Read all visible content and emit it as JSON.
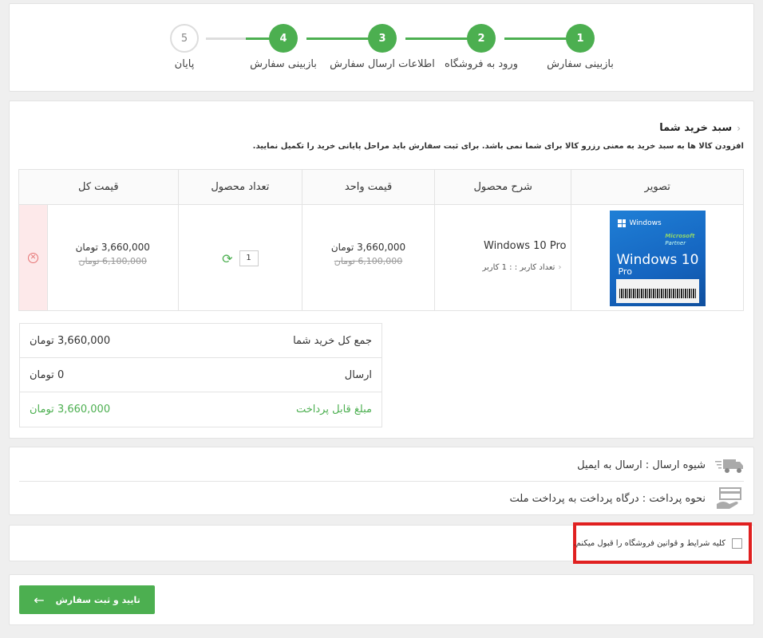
{
  "steps": [
    {
      "number": "1",
      "label": "بازبینی سفارش",
      "state": "done"
    },
    {
      "number": "2",
      "label": "ورود به فروشگاه",
      "state": "done"
    },
    {
      "number": "3",
      "label": "اطلاعات ارسال سفارش",
      "state": "done"
    },
    {
      "number": "4",
      "label": "بازبینی سفارش",
      "state": "done"
    },
    {
      "number": "5",
      "label": "پایان",
      "state": "pending"
    }
  ],
  "cart": {
    "title": "سبد خرید شما",
    "note": "افزودن کالا ها به سبد خرید به معنی رزرو کالا برای شما نمی باشد. برای ثبت سفارش باید مراحل پایانی خرید را تکمیل نمایید.",
    "columns": {
      "image": "تصویر",
      "description": "شرح محصول",
      "unit_price": "قیمت واحد",
      "quantity": "تعداد محصول",
      "total": "قیمت کل"
    },
    "item": {
      "name": "Windows 10 Pro",
      "users": "تعداد کاربر : : 1 کاربر",
      "unit_price": "3,660,000 تومان",
      "unit_price_old": "6,100,000 تومان",
      "quantity": "1",
      "total": "3,660,000 تومان",
      "total_old": "6,100,000 تومان",
      "box": {
        "brand": "Windows",
        "partner_line1": "Microsoft",
        "partner_line2": "Partner",
        "product": "Windows 10",
        "edition": "Pro"
      }
    },
    "summary": {
      "subtotal_label": "جمع کل خرید شما",
      "subtotal_value": "3,660,000 تومان",
      "shipping_label": "ارسال",
      "shipping_value": "0 تومان",
      "payable_label": "مبلغ قابل پرداخت",
      "payable_value": "3,660,000 تومان"
    }
  },
  "delivery": {
    "shipping_method": "شیوه ارسال : ارسال به ایمیل",
    "payment_method": "نحوه پرداخت : درگاه پرداخت به پرداخت ملت"
  },
  "terms": {
    "label": "کلیه شرایط و قوانین فروشگاه را قبول میکنم."
  },
  "submit": {
    "label": "تایید و ثبت سفارش"
  },
  "colors": {
    "accent": "#4caf50",
    "highlight": "#e02020"
  }
}
